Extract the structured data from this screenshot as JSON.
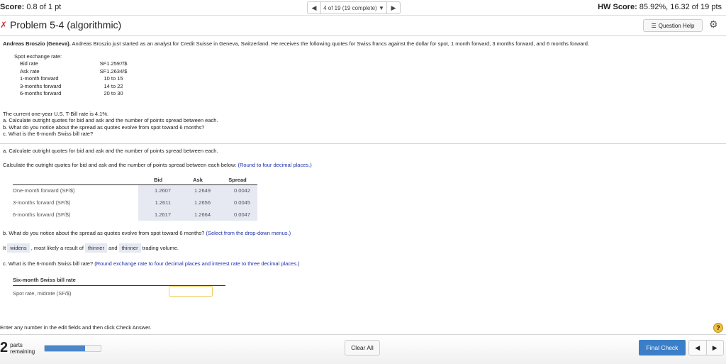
{
  "header": {
    "score_label": "Score:",
    "score_value": "0.8 of 1 pt",
    "nav_position": "4 of 19 (19 complete)",
    "hw_label": "HW Score:",
    "hw_value": "85.92%, 16.32 of 19 pts"
  },
  "problem": {
    "title": "Problem 5-4 (algorithmic)",
    "question_help": "Question Help",
    "intro_bold": "Andreas Broszio (Geneva).",
    "intro": " Andreas Broszio just started as an analyst for Credit Suisse in Geneva, Switzerland. He receives the following quotes for Swiss francs against the dollar for spot, 1 month forward, 3 months forward, and 6 months forward.",
    "quotes_heading": "Spot exchange rate:",
    "quotes": [
      {
        "label": "Bid rate",
        "value": "SF1.2597/$"
      },
      {
        "label": "Ask rate",
        "value": "SF1.2634/$"
      },
      {
        "label": "1-month forward",
        "value": "10 to 15"
      },
      {
        "label": "3-months forward",
        "value": "14 to 22"
      },
      {
        "label": "6-months forward",
        "value": "20 to 30"
      }
    ],
    "tbill": "The current one-year U.S. T-Bill rate is 4.1%.",
    "qa": "a. Calculate outright quotes for bid and ask and the number of points spread between each.",
    "qb": "b. What do you notice about the spread as quotes evolve from spot toward 6 months?",
    "qc": "c. What is the 6-month Swiss bill rate?"
  },
  "part_a": {
    "heading": "a. Calculate outright quotes for bid and ask and the number of points spread between each.",
    "instruction": "Calculate the outright quotes for bid and ask and the number of points spread between each below:",
    "hint": "(Round to four decimal places.)",
    "columns": [
      "Bid",
      "Ask",
      "Spread"
    ],
    "rows": [
      {
        "label": "One-month forward (SF/$)",
        "bid": "1.2607",
        "ask": "1.2649",
        "spread": "0.0042"
      },
      {
        "label": "3-months forward (SF/$)",
        "bid": "1.2611",
        "ask": "1.2656",
        "spread": "0.0045"
      },
      {
        "label": "6-months forward (SF/$)",
        "bid": "1.2617",
        "ask": "1.2664",
        "spread": "0.0047"
      }
    ]
  },
  "part_b": {
    "question": "b. What do you notice about the spread as quotes evolve from spot toward 6 months?",
    "hint": "(Select from the drop-down menus.)",
    "s1": "It",
    "dd1": "widens",
    "s2": ", most likely a result of",
    "dd2": "thinner",
    "s3": "and",
    "dd3": "thinner",
    "s4": "trading volume."
  },
  "part_c": {
    "question": "c. What is the 6-month Swiss bill rate?",
    "hint": "(Round exchange rate to four decimal places and interest rate to three decimal places.)",
    "table_title": "Six-month Swiss bill rate",
    "row_label": "Spot rate, midrate (SF/$)",
    "input_value": ""
  },
  "footer": {
    "instruction": "Enter any number in the edit fields and then click Check Answer.",
    "parts_count": "2",
    "parts_label1": "parts",
    "parts_label2": "remaining",
    "progress_fraction": 0.72,
    "clear_all": "Clear All",
    "final_check": "Final Check"
  }
}
